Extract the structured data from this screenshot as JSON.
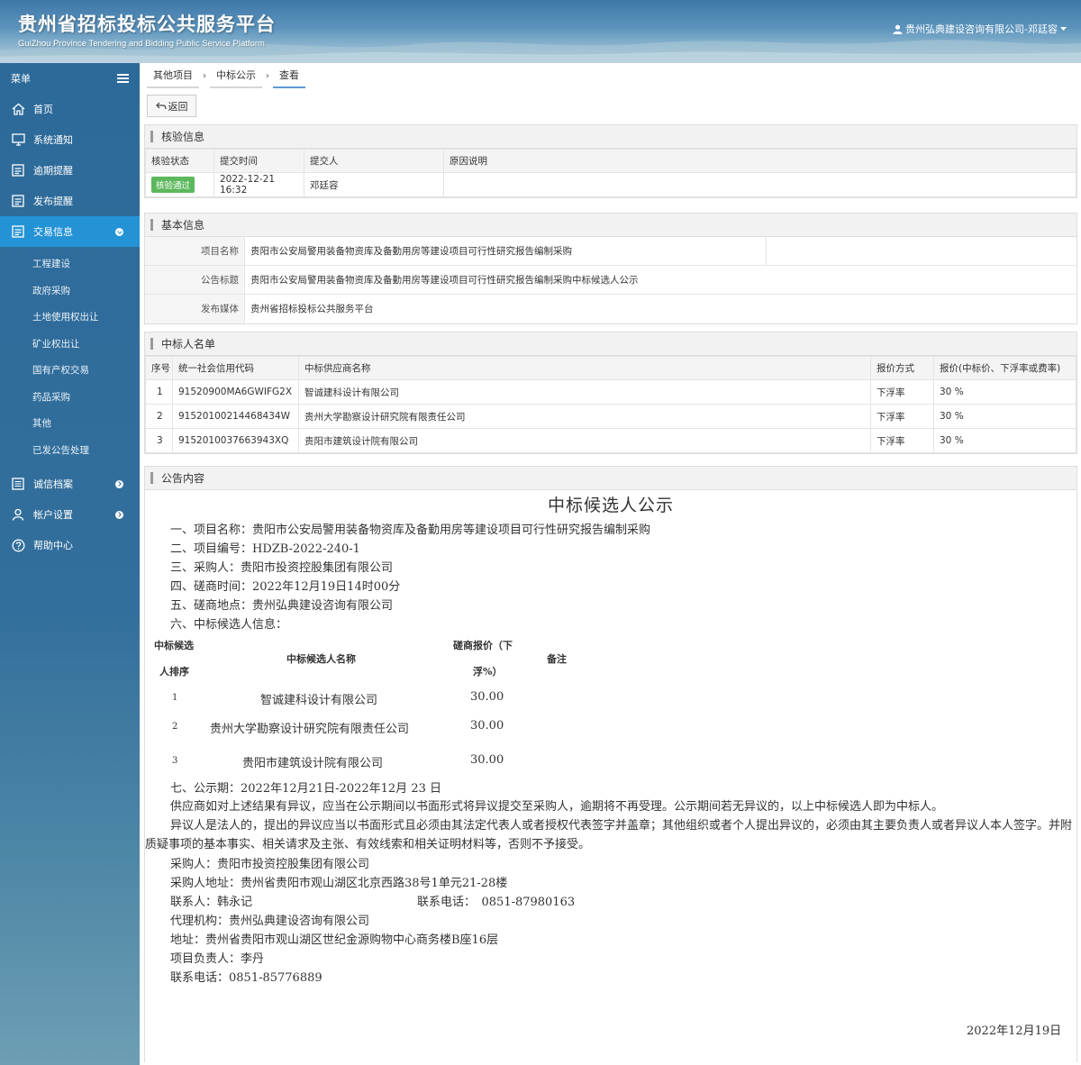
{
  "header": {
    "title": "贵州省招标投标公共服务平台",
    "subtitle": "GuiZhou Province Tendering and Bidding Public Service Platform",
    "user": "贵州弘典建设咨询有限公司-邓廷容"
  },
  "sidebar": {
    "menu_label": "菜单",
    "items": [
      {
        "label": "首页",
        "icon": "home-icon"
      },
      {
        "label": "系统通知",
        "icon": "monitor-icon"
      },
      {
        "label": "逾期提醒",
        "icon": "list-icon"
      },
      {
        "label": "发布提醒",
        "icon": "list-icon"
      },
      {
        "label": "交易信息",
        "icon": "list-icon",
        "active": true
      },
      {
        "label": "诚信档案",
        "icon": "doc-icon"
      },
      {
        "label": "帐户设置",
        "icon": "user-icon"
      },
      {
        "label": "帮助中心",
        "icon": "help-icon"
      }
    ],
    "subitems": [
      "工程建设",
      "政府采购",
      "土地使用权出让",
      "矿业权出让",
      "国有产权交易",
      "药品采购",
      "其他",
      "已发公告处理"
    ]
  },
  "breadcrumb": [
    "其他项目",
    "中标公示",
    "查看"
  ],
  "back_label": "返回",
  "verify": {
    "title": "核验信息",
    "columns": [
      "核验状态",
      "提交时间",
      "提交人",
      "原因说明"
    ],
    "status": "核验通过",
    "time": "2022-12-21 16:32",
    "submitter": "邓廷容",
    "reason": ""
  },
  "basic": {
    "title": "基本信息",
    "rows": [
      {
        "label": "项目名称",
        "value": "贵阳市公安局警用装备物资库及备勤用房等建设项目可行性研究报告编制采购"
      },
      {
        "label": "公告标题",
        "value": "贵阳市公安局警用装备物资库及备勤用房等建设项目可行性研究报告编制采购中标候选人公示"
      },
      {
        "label": "发布媒体",
        "value": "贵州省招标投标公共服务平台"
      }
    ]
  },
  "winners": {
    "title": "中标人名单",
    "columns": [
      "序号",
      "统一社会信用代码",
      "中标供应商名称",
      "报价方式",
      "报价(中标价、下浮率或费率)"
    ],
    "rows": [
      {
        "no": "1",
        "code": "91520900MA6GWIFG2X",
        "name": "智诚建科设计有限公司",
        "method": "下浮率",
        "price": "30 %"
      },
      {
        "no": "2",
        "code": "91520100214468434W",
        "name": "贵州大学勘察设计研究院有限责任公司",
        "method": "下浮率",
        "price": "30 %"
      },
      {
        "no": "3",
        "code": "9152010037663943XQ",
        "name": "贵阳市建筑设计院有限公司",
        "method": "下浮率",
        "price": "30 %"
      }
    ]
  },
  "notice": {
    "panel_title": "公告内容",
    "title": "中标候选人公示",
    "lines": [
      "一、项目名称：贵阳市公安局警用装备物资库及备勤用房等建设项目可行性研究报告编制采购",
      "二、项目编号：HDZB-2022-240-1",
      "三、采购人：贵阳市投资控股集团有限公司",
      "四、磋商时间：2022年12月19日14时00分",
      "五、磋商地点：贵州弘典建设咨询有限公司",
      "六、中标候选人信息："
    ],
    "table_headers": {
      "rank_1": "中标候选",
      "rank_2": "人排序",
      "name": "中标候选人名称",
      "price_1": "磋商报价（下",
      "price_2": "浮%）",
      "remark": "备注"
    },
    "candidates": [
      {
        "rank": "1",
        "name": "智诚建科设计有限公司",
        "price": "30.00"
      },
      {
        "rank": "2",
        "name": "贵州大学勘察设计研究院有限责任公司",
        "price": "30.00"
      },
      {
        "rank": "3",
        "name": "贵阳市建筑设计院有限公司",
        "price": "30.00"
      }
    ],
    "period": "七、公示期：2022年12月21日-2022年12月 23 日",
    "para1": "供应商如对上述结果有异议，应当在公示期间以书面形式将异议提交至采购人，逾期将不再受理。公示期间若无异议的，以上中标候选人即为中标人。",
    "para2": "异议人是法人的，提出的异议应当以书面形式且必须由其法定代表人或者授权代表签字并盖章；其他组织或者个人提出异议的，必须由其主要负责人或者异议人本人签字。并附质疑事项的基本事实、相关请求及主张、有效线索和相关证明材料等，否则不予接受。",
    "purchaser": "采购人：贵阳市投资控股集团有限公司",
    "purchaser_addr": "采购人地址：贵州省贵阳市观山湖区北京西路38号1单元21-28楼",
    "contact": "联系人：韩永记",
    "contact_phone": "联系电话：　0851-87980163",
    "agency": "代理机构：贵州弘典建设咨询有限公司",
    "agency_addr": "地址：贵州省贵阳市观山湖区世纪金源购物中心商务楼B座16层",
    "manager": "项目负责人：李丹",
    "agency_phone": "联系电话：0851-85776889",
    "date": "2022年12月19日"
  }
}
